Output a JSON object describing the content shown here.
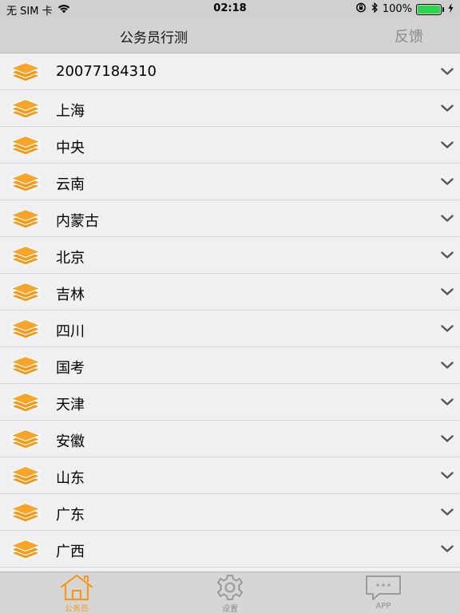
{
  "status_bar": {
    "carrier": "无 SIM 卡",
    "time": "02:18",
    "battery": "100%",
    "icons": [
      "wifi-icon",
      "orientation-lock-icon",
      "bluetooth-icon",
      "battery-icon",
      "charging-icon"
    ]
  },
  "nav": {
    "title": "公务员行测",
    "feedback_label": "反馈"
  },
  "list": {
    "items": [
      {
        "label": "20077184310"
      },
      {
        "label": "上海"
      },
      {
        "label": "中央"
      },
      {
        "label": "云南"
      },
      {
        "label": "内蒙古"
      },
      {
        "label": "北京"
      },
      {
        "label": "吉林"
      },
      {
        "label": "四川"
      },
      {
        "label": "国考"
      },
      {
        "label": "天津"
      },
      {
        "label": "安徽"
      },
      {
        "label": "山东"
      },
      {
        "label": "广东"
      },
      {
        "label": "广西"
      }
    ],
    "item_icon": "stack-icon",
    "item_chevron": "chevron-down-icon"
  },
  "tab_bar": {
    "tabs": [
      {
        "label": "公务员",
        "icon": "home-icon",
        "active": true
      },
      {
        "label": "设置",
        "icon": "gear-icon",
        "active": false
      },
      {
        "label": "APP",
        "icon": "chat-bubble-icon",
        "active": false
      }
    ]
  },
  "colors": {
    "accent": "#f39a1e",
    "nav_bg": "#d3d3d3",
    "list_bg": "#f0f0f2",
    "battery_green": "#2bd64a"
  }
}
